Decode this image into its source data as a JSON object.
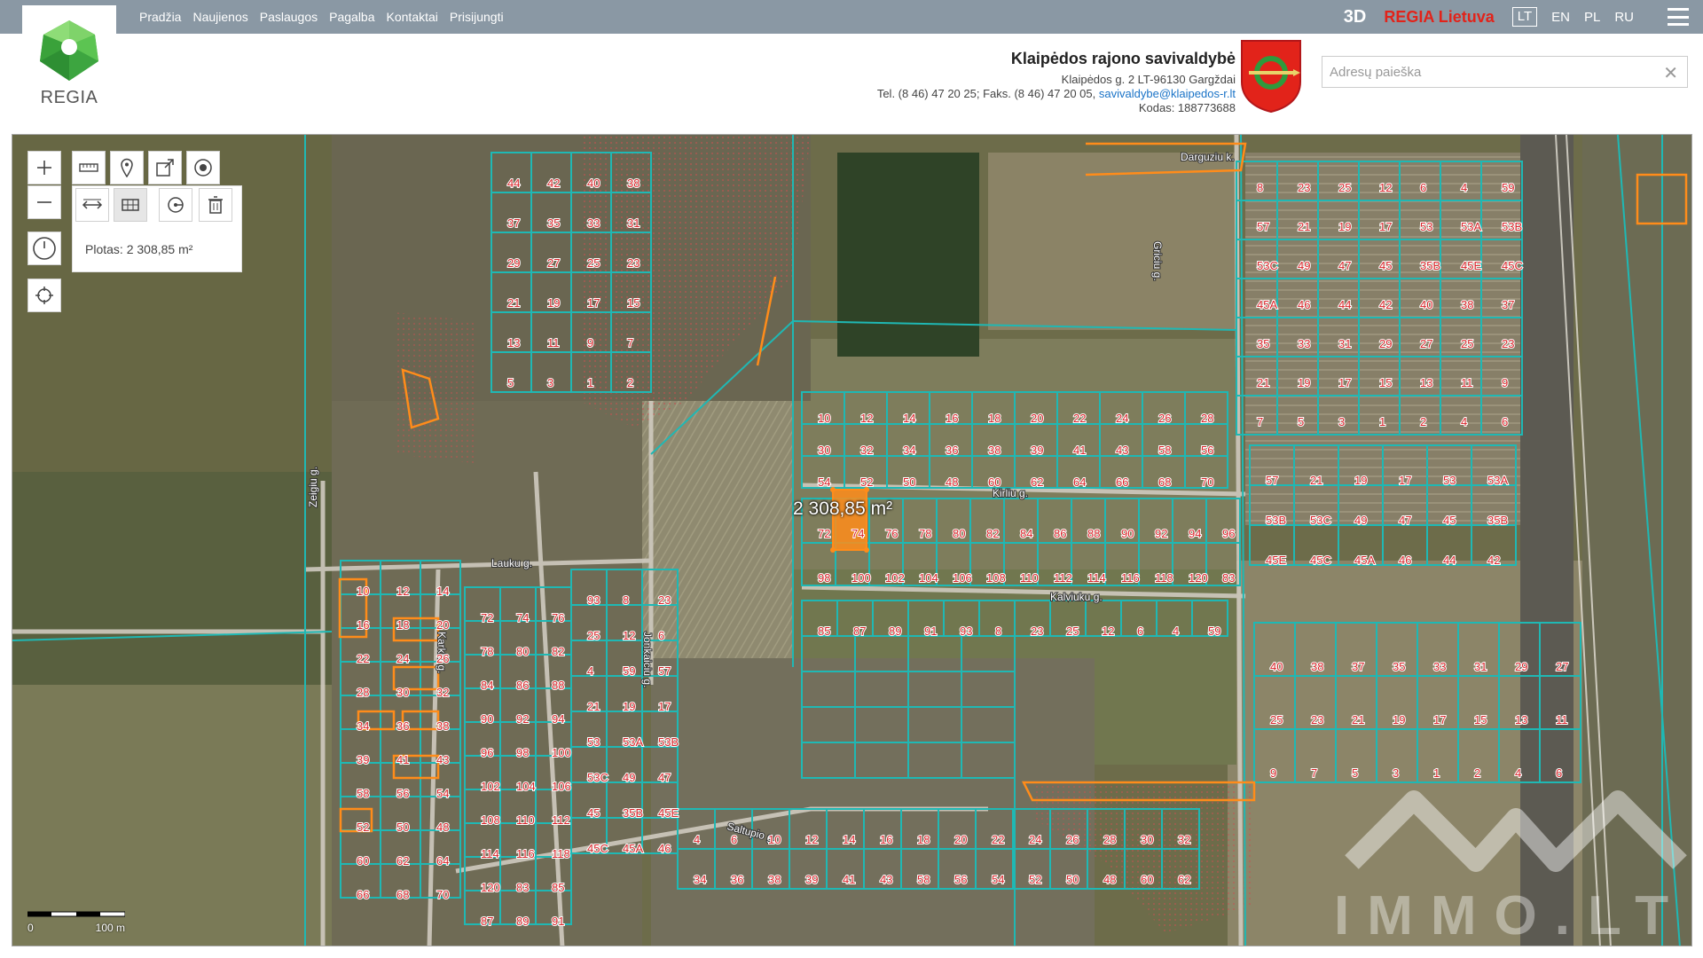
{
  "nav": {
    "items": [
      "Pradžia",
      "Naujienos",
      "Paslaugos",
      "Pagalba",
      "Kontaktai",
      "Prisijungti"
    ]
  },
  "topright": {
    "btn3d": "3D",
    "regia_lt": "REGIA Lietuva",
    "languages": [
      "LT",
      "EN",
      "PL",
      "RU"
    ],
    "active_language": "LT"
  },
  "logo": {
    "text": "REGIA"
  },
  "municipality": {
    "name": "Klaipėdos rajono savivaldybė",
    "address": "Klaipėdos g. 2 LT-96130 Gargždai",
    "phone": "Tel. (8 46) 47 20 25; Faks. (8 46) 47 20 05,",
    "email": "savivaldybe@klaipedos-r.lt",
    "code": "Kodas: 188773688"
  },
  "search": {
    "placeholder": "Adresų paieška",
    "value": "",
    "clear": "✕"
  },
  "tools": {
    "measure_result": "Plotas: 2 308,85 m²"
  },
  "map": {
    "selected_area_label": "2 308,85 m²",
    "scale_left": "0",
    "scale_right": "100 m",
    "streets": [
      "Kirliu g.",
      "Kalviuku g.",
      "Lauku g.",
      "Karklu g.",
      "Jonkaiciu g.",
      "Saltupio g.",
      "Zeigiu g.",
      "Darguziu k.",
      "Griciu g."
    ],
    "parcel_numbers": [
      "8",
      "23",
      "25",
      "12",
      "6",
      "4",
      "59",
      "57",
      "21",
      "19",
      "17",
      "53",
      "53A",
      "53B",
      "53C",
      "49",
      "47",
      "45",
      "35B",
      "45E",
      "45C",
      "45A",
      "46",
      "44",
      "42",
      "40",
      "38",
      "37",
      "35",
      "33",
      "31",
      "29",
      "27",
      "25",
      "23",
      "21",
      "19",
      "17",
      "15",
      "13",
      "11",
      "9",
      "7",
      "5",
      "3",
      "1",
      "2",
      "4",
      "6",
      "10",
      "12",
      "14",
      "16",
      "18",
      "20",
      "22",
      "24",
      "26",
      "28",
      "30",
      "32",
      "34",
      "36",
      "38",
      "39",
      "41",
      "43",
      "58",
      "56",
      "54",
      "52",
      "50",
      "48",
      "60",
      "62",
      "64",
      "66",
      "68",
      "70",
      "72",
      "74",
      "76",
      "78",
      "80",
      "82",
      "84",
      "86",
      "88",
      "90",
      "92",
      "94",
      "96",
      "98",
      "100",
      "102",
      "104",
      "106",
      "108",
      "110",
      "112",
      "114",
      "116",
      "118",
      "120",
      "83",
      "85",
      "87",
      "89",
      "91",
      "93"
    ]
  },
  "watermark": {
    "text": "IMMO.LT"
  },
  "colors": {
    "topbar": "#8a98a4",
    "parcel_line": "#1fb8b4",
    "parcel_number": "#d8262b",
    "selection": "#ff8c1a",
    "accent": "#e2231a"
  }
}
